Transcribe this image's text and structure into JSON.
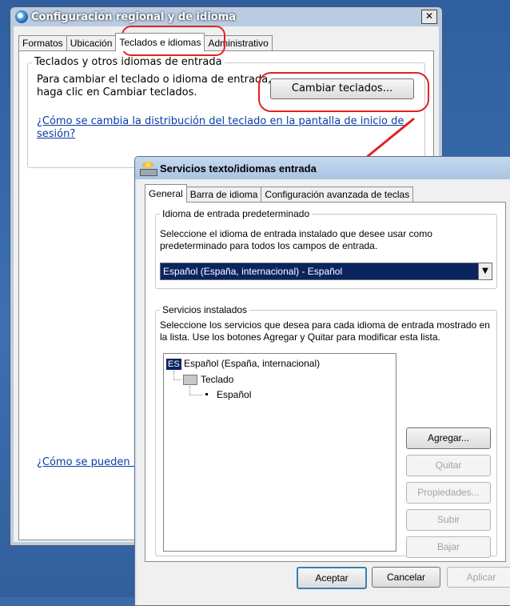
{
  "back_window": {
    "title": "Configuración regional y de idioma",
    "close": "✕",
    "tabs": [
      "Formatos",
      "Ubicación",
      "Teclados e idiomas",
      "Administrativo"
    ],
    "group_title": "Teclados y otros idiomas de entrada",
    "group_text": "Para cambiar el teclado o idioma de entrada, haga clic en Cambiar teclados.",
    "change_button": "Cambiar teclados...",
    "link1": "¿Cómo se cambia la distribución del teclado en la pantalla de inicio de sesión?",
    "link2": "¿Cómo se pueden in"
  },
  "dialog": {
    "title": "Servicios texto/idiomas entrada",
    "close": "x",
    "tabs": [
      "General",
      "Barra de idioma",
      "Configuración avanzada de teclas"
    ],
    "default_group": {
      "title": "Idioma de entrada predeterminado",
      "text": "Seleccione el idioma de entrada instalado que desee usar como predeterminado para todos los campos de entrada.",
      "selected": "Español (España, internacional) - Español"
    },
    "services_group": {
      "title": "Servicios instalados",
      "text": "Seleccione los servicios que desea para cada idioma de entrada mostrado en la lista. Use los botones Agregar y Quitar para modificar esta lista.",
      "tree": {
        "lang_badge": "ES",
        "language": "Español (España, internacional)",
        "category": "Teclado",
        "layout": "Español"
      },
      "buttons": {
        "add": "Agregar...",
        "remove": "Quitar",
        "properties": "Propiedades...",
        "up": "Subir",
        "down": "Bajar"
      }
    },
    "footer": {
      "ok": "Aceptar",
      "cancel": "Cancelar",
      "apply": "Aplicar"
    }
  },
  "colors": {
    "annotation_red": "#e32222",
    "selection_blue": "#0a2460",
    "link_blue": "#0a3da6"
  }
}
